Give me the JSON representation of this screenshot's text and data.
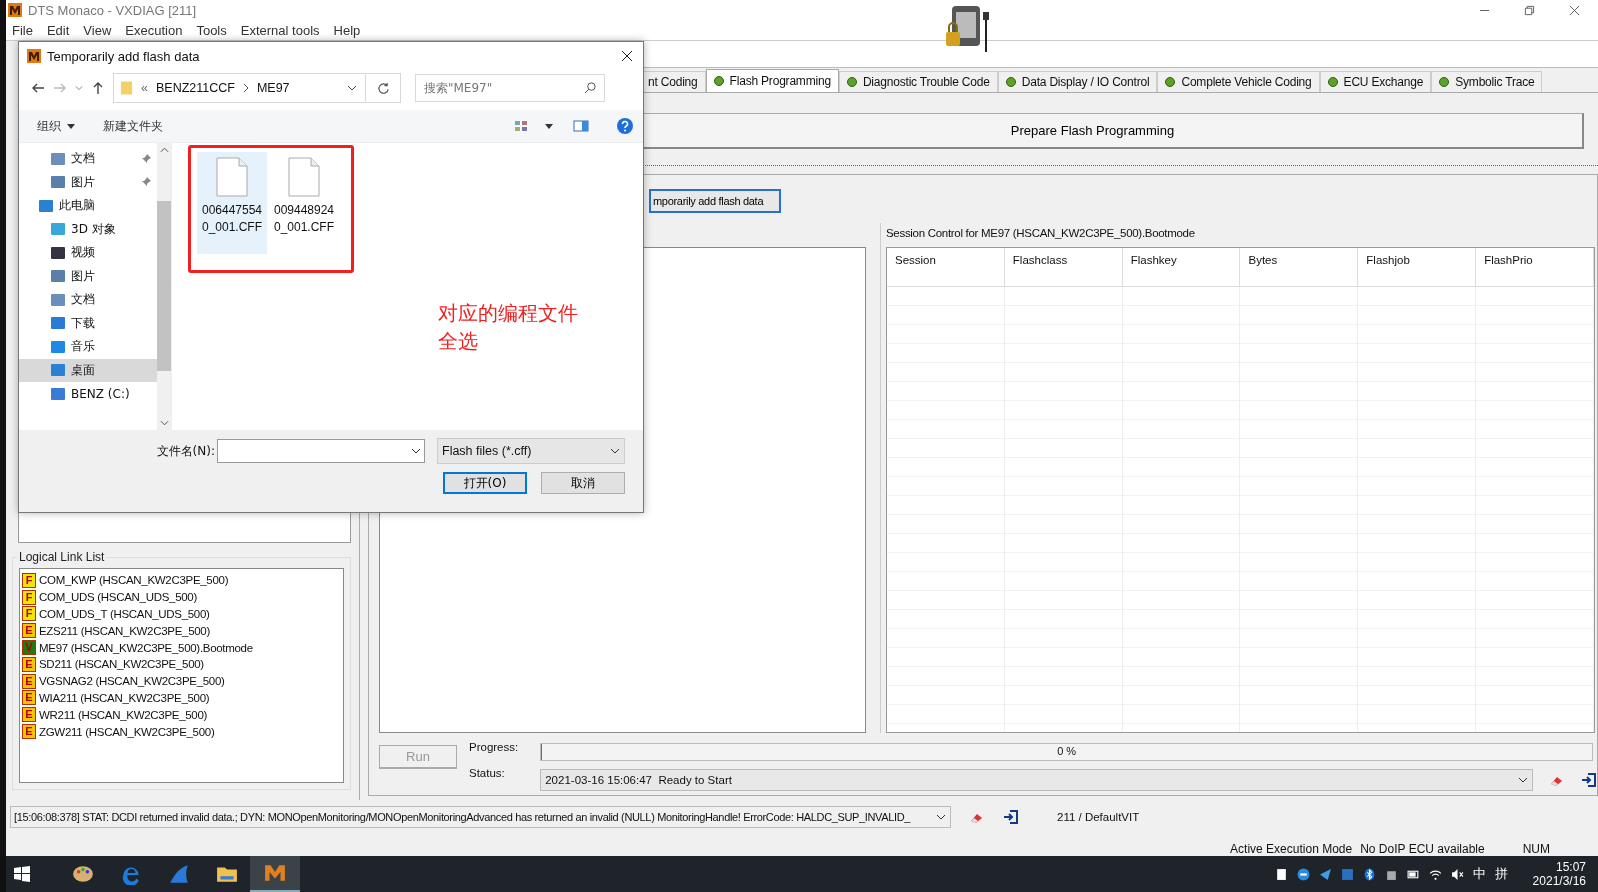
{
  "window": {
    "title": "DTS Monaco - VXDIAG [211]"
  },
  "menu": [
    "File",
    "Edit",
    "View",
    "Execution",
    "Tools",
    "External tools",
    "Help"
  ],
  "tabs": [
    {
      "label": "nt Coding",
      "selected": false,
      "dot": false
    },
    {
      "label": "Flash Programming",
      "selected": true,
      "dot": true
    },
    {
      "label": "Diagnostic Trouble Code",
      "selected": false,
      "dot": true
    },
    {
      "label": "Data Display / IO Control",
      "selected": false,
      "dot": true
    },
    {
      "label": "Complete Vehicle Coding",
      "selected": false,
      "dot": true
    },
    {
      "label": "ECU Exchange",
      "selected": false,
      "dot": true
    },
    {
      "label": "Symbolic Trace",
      "selected": false,
      "dot": true
    }
  ],
  "prepare_button": "Prepare Flash Programming",
  "add_flash_button": "mporarily add flash data",
  "session_control": {
    "title": "Session Control for ME97 (HSCAN_KW2C3PE_500).Bootmode",
    "columns": [
      "Session",
      "Flashclass",
      "Flashkey",
      "Bytes",
      "Flashjob",
      "FlashPrio"
    ]
  },
  "run_button": {
    "label": "Run",
    "disabled": true
  },
  "progress": {
    "label": "Progress:",
    "level": 0,
    "reading": "0 %"
  },
  "status": {
    "label": "Status:",
    "value": "2021-03-16 15:06:47  Ready to Start"
  },
  "logical_links": {
    "title": "Logical Link List",
    "items": [
      {
        "badge": "F",
        "color": "#f5e400",
        "name": "COM_KWP (HSCAN_KW2C3PE_500)"
      },
      {
        "badge": "F",
        "color": "#f5e400",
        "name": "COM_UDS (HSCAN_UDS_500)"
      },
      {
        "badge": "F",
        "color": "#f5e400",
        "name": "COM_UDS_T (HSCAN_UDS_500)"
      },
      {
        "badge": "E",
        "color": "#f7c400",
        "name": "EZS211 (HSCAN_KW2C3PE_500)"
      },
      {
        "badge": "V",
        "color": "#1f7a12",
        "name": "ME97 (HSCAN_KW2C3PE_500).Bootmode"
      },
      {
        "badge": "E",
        "color": "#f7c400",
        "name": "SD211 (HSCAN_KW2C3PE_500)"
      },
      {
        "badge": "E",
        "color": "#f7c400",
        "name": "VGSNAG2 (HSCAN_KW2C3PE_500)"
      },
      {
        "badge": "E",
        "color": "#f7c400",
        "name": "WIA211 (HSCAN_KW2C3PE_500)"
      },
      {
        "badge": "E",
        "color": "#f7c400",
        "name": "WR211 (HSCAN_KW2C3PE_500)"
      },
      {
        "badge": "E",
        "color": "#f7c400",
        "name": "ZGW211 (HSCAN_KW2C3PE_500)"
      }
    ]
  },
  "log": {
    "text": "[15:06:08:378] STAT: DCDI returned invalid data.; DYN: MONOpenMonitoring/MONOpenMonitoringAdvanced has returned an invalid (NULL) MonitoringHandle! ErrorCode: HALDC_SUP_INVALID_",
    "vit": "211 / DefaultVIT"
  },
  "mode_bar": [
    "Active Execution Mode",
    "No DoIP ECU available",
    "NUM"
  ],
  "dialog": {
    "title": "Temporarily add flash data",
    "path_overflow": "«",
    "path": [
      "BENZ211CCF",
      "ME97"
    ],
    "search_placeholder": "搜索\"ME97\"",
    "organize": "组织",
    "new_folder": "新建文件夹",
    "nav": [
      {
        "label": "文档",
        "kind": "doc",
        "pinned": true,
        "selected": false
      },
      {
        "label": "图片",
        "kind": "pic",
        "pinned": true,
        "selected": false
      },
      {
        "label": "此电脑",
        "kind": "pc",
        "pinned": false,
        "selected": false,
        "children": [
          {
            "label": "3D 对象",
            "kind": "cube",
            "pinned": false,
            "selected": false
          },
          {
            "label": "视频",
            "kind": "film",
            "pinned": false,
            "selected": false
          },
          {
            "label": "图片",
            "kind": "pic",
            "pinned": false,
            "selected": false
          },
          {
            "label": "文档",
            "kind": "doc",
            "pinned": false,
            "selected": false
          },
          {
            "label": "下载",
            "kind": "down",
            "pinned": false,
            "selected": false
          },
          {
            "label": "音乐",
            "kind": "music",
            "pinned": false,
            "selected": false
          },
          {
            "label": "桌面",
            "kind": "desk",
            "pinned": false,
            "selected": true
          },
          {
            "label": "BENZ (C:)",
            "kind": "drive",
            "pinned": false,
            "selected": false
          }
        ]
      }
    ],
    "files": [
      {
        "name": "0064475540_001.CFF",
        "selected": true
      },
      {
        "name": "0094489240_001.CFF",
        "selected": false
      }
    ],
    "annotation": [
      "对应的编程文件",
      "全选"
    ],
    "filename_label": "文件名(N):",
    "filter": "Flash files (*.cff)",
    "open_button": "打开(O)",
    "cancel_button": "取消"
  },
  "taskbar": {
    "apps": [
      {
        "kind": "paint",
        "active": false
      },
      {
        "kind": "edge",
        "active": false
      },
      {
        "kind": "fin",
        "active": false
      },
      {
        "kind": "folder",
        "active": false
      },
      {
        "kind": "monaco",
        "active": true
      }
    ],
    "ime": "中",
    "ime_mode": "拼",
    "time": "15:07",
    "date": "2021/3/16"
  }
}
